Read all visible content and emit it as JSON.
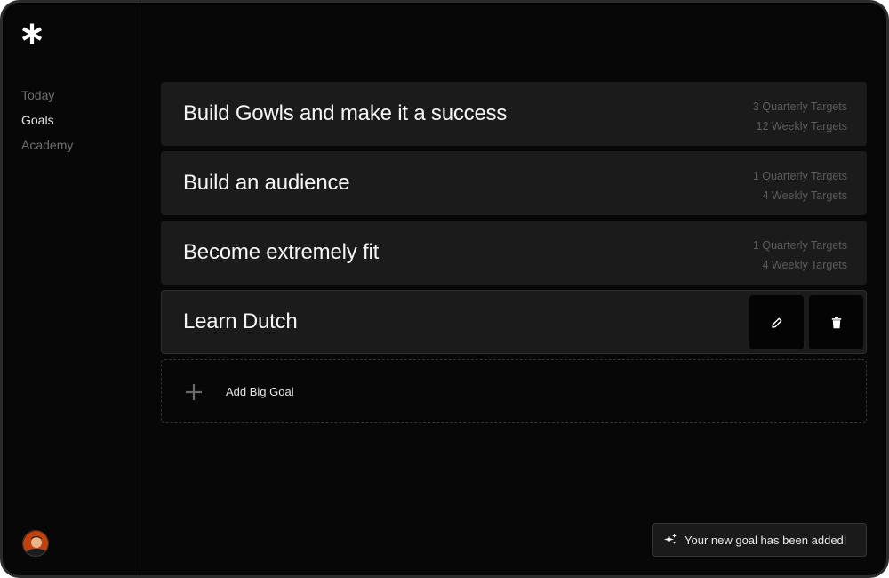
{
  "nav": {
    "items": [
      {
        "label": "Today",
        "active": false
      },
      {
        "label": "Goals",
        "active": true
      },
      {
        "label": "Academy",
        "active": false
      }
    ]
  },
  "goals": [
    {
      "title": "Build Gowls and make it a success",
      "quarterly": "3 Quarterly Targets",
      "weekly": "12 Weekly Targets"
    },
    {
      "title": "Build an audience",
      "quarterly": "1 Quarterly Targets",
      "weekly": "4 Weekly Targets"
    },
    {
      "title": "Become extremely fit",
      "quarterly": "1 Quarterly Targets",
      "weekly": "4 Weekly Targets"
    },
    {
      "title": "Learn Dutch",
      "actions": [
        "pencil-icon",
        "trash-icon"
      ]
    }
  ],
  "add_goal": {
    "label": "Add Big Goal",
    "icon": "plus-icon"
  },
  "toast": {
    "icon": "sparkles-icon",
    "message": "Your new goal has been added!"
  },
  "icons": {
    "logo": "asterisk-logo",
    "avatar": "user-avatar"
  },
  "colors": {
    "background": "#070707",
    "card": "#1b1b1b",
    "text": "#f5f5f5",
    "muted": "#5c5c5c"
  }
}
